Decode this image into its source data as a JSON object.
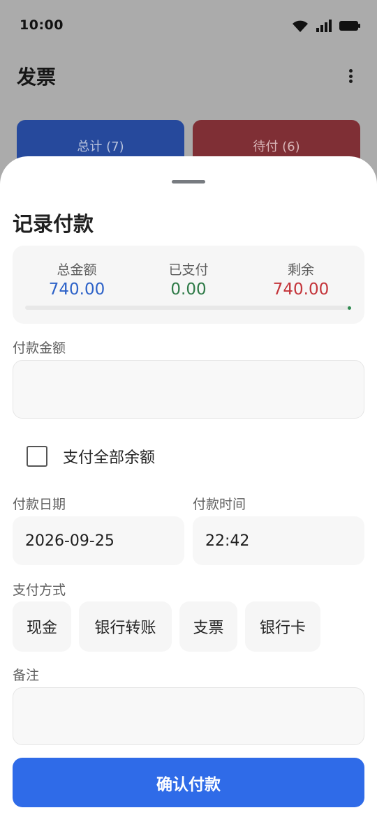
{
  "status_bar": {
    "time": "10:00",
    "icons": [
      "wifi-icon",
      "signal-icon",
      "battery-icon"
    ]
  },
  "app_bar": {
    "title": "发票",
    "menu_icon": "more-vert-icon"
  },
  "summary_cards": {
    "total": {
      "label": "总计 (7)",
      "color": "#26499c"
    },
    "pending": {
      "label": "待付 (6)",
      "color": "#7f2f35"
    }
  },
  "sheet": {
    "title": "记录付款",
    "summary": {
      "total_label": "总金额",
      "total_value": "740.00",
      "paid_label": "已支付",
      "paid_value": "0.00",
      "remaining_label": "剩余",
      "remaining_value": "740.00",
      "paid_fraction": 0
    },
    "amount": {
      "label": "付款金额",
      "value": "",
      "placeholder": ""
    },
    "pay_full": {
      "label": "支付全部余额",
      "checked": false
    },
    "date": {
      "label": "付款日期",
      "value": "2026-09-25"
    },
    "time": {
      "label": "付款时间",
      "value": "22:42"
    },
    "method": {
      "label": "支付方式",
      "options": [
        "现金",
        "银行转账",
        "支票",
        "银行卡"
      ]
    },
    "note": {
      "label": "备注",
      "value": ""
    },
    "confirm_label": "确认付款"
  },
  "colors": {
    "accent": "#2f6be8",
    "total_blue": "#2d62c8",
    "paid_green": "#2e7a47",
    "remaining_red": "#c4343a"
  }
}
